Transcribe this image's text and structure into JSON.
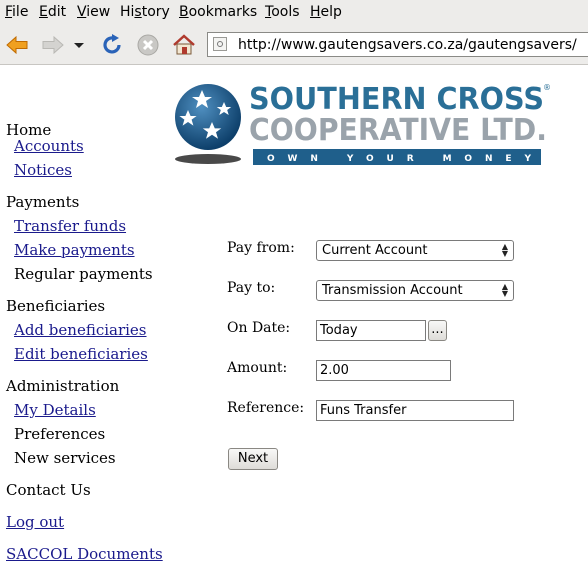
{
  "browser": {
    "menu": [
      "File",
      "Edit",
      "View",
      "History",
      "Bookmarks",
      "Tools",
      "Help"
    ],
    "url": "http://www.gautengsavers.co.za/gautengsavers/"
  },
  "logo": {
    "line1": "SOUTHERN CROSS",
    "line2": "COOPERATIVE LTD.",
    "tagline": "OWN YOUR MONEY",
    "mark": "®",
    "colors": {
      "blue": "#2a6f97",
      "grey": "#9aa3ab",
      "bar": "#1f5f8b"
    }
  },
  "nav": {
    "home": "Home",
    "accounts": "Accounts",
    "notices": "Notices",
    "payments": "Payments",
    "transfer_funds": "Transfer funds",
    "make_payments": "Make payments",
    "regular_payments": "Regular payments",
    "beneficiaries": "Beneficiaries",
    "add_beneficiaries": "Add beneficiaries",
    "edit_beneficiaries": "Edit beneficiaries",
    "administration": "Administration",
    "my_details": "My Details",
    "preferences": "Preferences",
    "new_services": "New services",
    "contact_us": "Contact Us",
    "log_out": "Log out",
    "saccol_documents": "SACCOL Documents"
  },
  "form": {
    "pay_from_label": "Pay from:",
    "pay_from_value": "Current Account",
    "pay_to_label": "Pay to:",
    "pay_to_value": "Transmission Account",
    "on_date_label": "On Date:",
    "on_date_value": "Today",
    "date_picker_label": "...",
    "amount_label": "Amount:",
    "amount_value": "2.00",
    "reference_label": "Reference:",
    "reference_value": "Funs Transfer",
    "next_label": "Next"
  },
  "icons": {
    "back": "back-arrow-icon",
    "forward": "forward-arrow-icon",
    "history": "chevron-down-icon",
    "reload": "reload-icon",
    "stop": "stop-icon",
    "home": "home-icon",
    "favicon": "site-favicon-icon"
  }
}
